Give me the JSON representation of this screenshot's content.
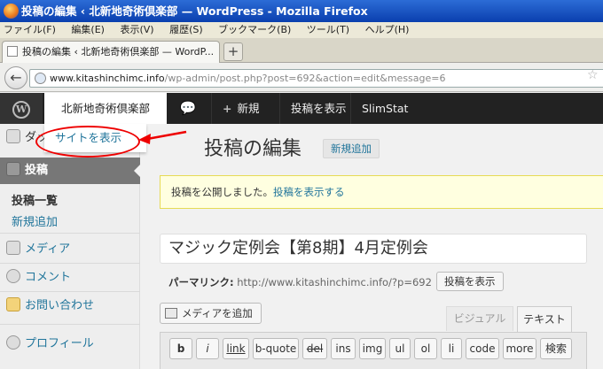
{
  "window": {
    "title": "投稿の編集 ‹ 北新地奇術倶楽部 — WordPress - Mozilla Firefox"
  },
  "menubar": {
    "items": [
      "ファイル(F)",
      "編集(E)",
      "表示(V)",
      "履歴(S)",
      "ブックマーク(B)",
      "ツール(T)",
      "ヘルプ(H)"
    ]
  },
  "tabs": {
    "active_label": "投稿の編集 ‹ 北新地奇術倶楽部 — WordP...",
    "new_tab": "+"
  },
  "nav": {
    "back": "←",
    "url_host": "www.kitashinchimc.info",
    "url_path": "/wp-admin/post.php?post=692&action=edit&message=6",
    "bookmark_star": "☆"
  },
  "adminbar": {
    "wp_logo": "W",
    "site_name": "北新地奇術倶楽部",
    "comments_icon": "💬",
    "new_plus": "+",
    "new_label": "新規",
    "view_post": "投稿を表示",
    "slimstat": "SlimStat"
  },
  "flyout": {
    "view_site": "サイトを表示"
  },
  "sidebar": {
    "dashboard": "ダッ",
    "posts": "投稿",
    "all_posts": "投稿一覧",
    "add_new": "新規追加",
    "media": "メディア",
    "comments": "コメント",
    "contact": "お問い合わせ",
    "profile": "プロフィール"
  },
  "main": {
    "heading": "投稿の編集",
    "add_new_button": "新規追加",
    "notice_text": "投稿を公開しました。",
    "notice_link": "投稿を表示する",
    "post_title": "マジック定例会【第8期】4月定例会",
    "permalink_label": "パーマリンク:",
    "permalink_url": "http://www.kitashinchimc.info/?p=692",
    "view_post_button": "投稿を表示",
    "add_media_button": "メディアを追加",
    "tab_visual": "ビジュアル",
    "tab_text": "テキスト"
  },
  "quicktags": [
    "b",
    "i",
    "link",
    "b-quote",
    "del",
    "ins",
    "img",
    "ul",
    "ol",
    "li",
    "code",
    "more",
    "検索"
  ]
}
